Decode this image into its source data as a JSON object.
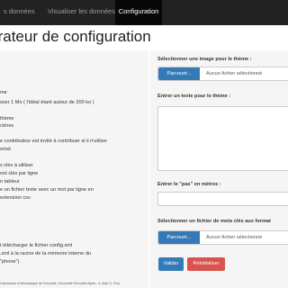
{
  "nav": {
    "items": [
      {
        "label": "s données"
      },
      {
        "label": "Visualiser les données"
      },
      {
        "label": "Configuration"
      }
    ]
  },
  "page": {
    "title": "Générateur de configuration"
  },
  "help": {
    "lines": [
      "me",
      "sser 1 Mo ( l'idéal étant autour de 200 ko )",
      "thème",
      "ctères",
      "e contributeur est invité à contribuer si il n'utilise",
      "orisé",
      "s clés à utiliser",
      "not clés par ligne",
      "n tableur",
      "e un fichier texte avec un mot par ligne en",
      "extension csv",
      "t télécharger le fichier config.xml",
      ".xml à la racine de la mémoire interne du",
      "\"phone\")"
    ],
    "footer": "Laboratoire d'Informatique de Grenoble, Université Grenoble Alpes - A. Bali, D. Four"
  },
  "form": {
    "image_label": "Sélectionner une image pour le thème :",
    "image_button": "Parcourir...",
    "image_status": "Aucun fichier sélectionné",
    "text_label": "Entrer un texte pour le thème :",
    "step_label": "Entrer le \"pas\" en mètres :",
    "keywords_label": "Sélectionner un fichier de mots clés aux format",
    "keywords_button": "Parcourir...",
    "keywords_status": "Aucun fichier sélectionné",
    "validate_button": "Valider",
    "reset_button": "Réinitialiser"
  },
  "colors": {
    "navbar": "#222222",
    "navbar_active": "#080808",
    "primary": "#337ab7",
    "danger": "#d9534f"
  }
}
